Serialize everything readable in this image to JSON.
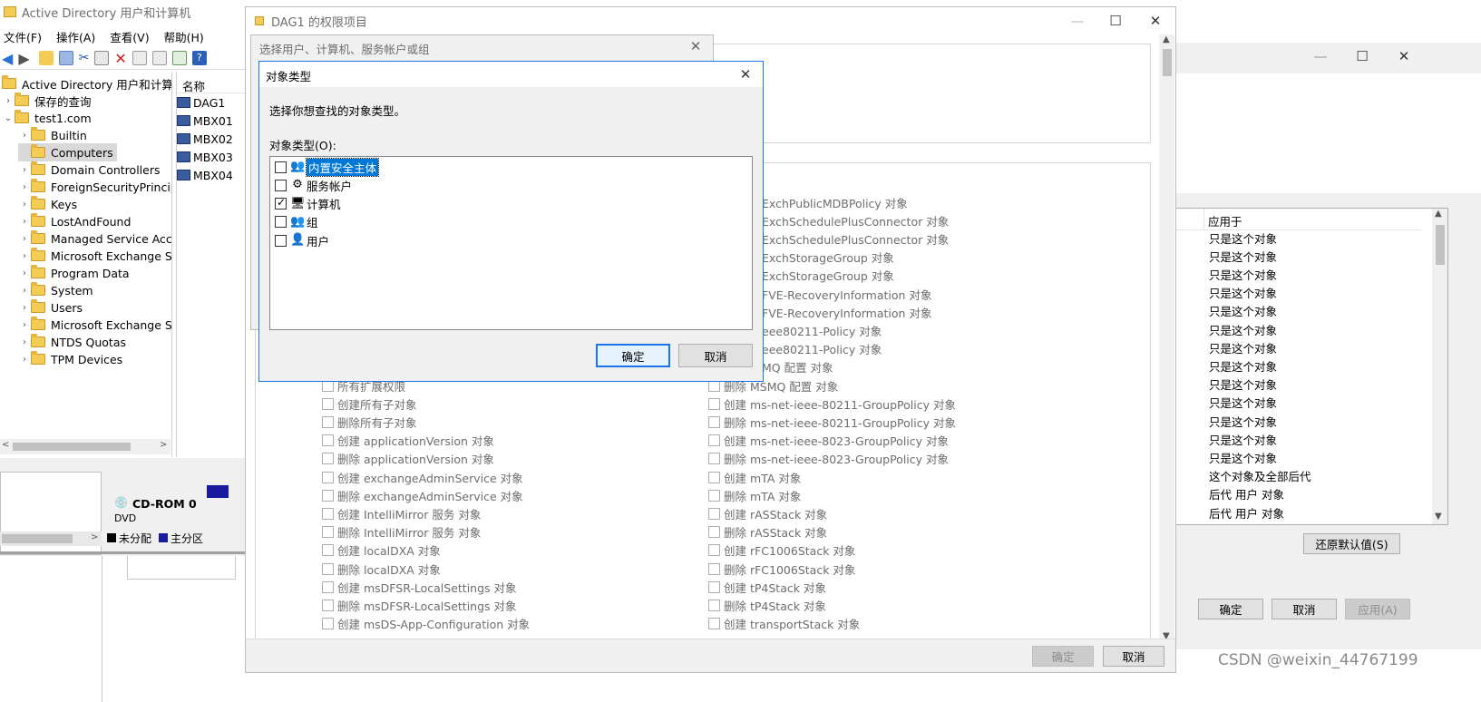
{
  "ad_window": {
    "title": "Active Directory 用户和计算机",
    "menu": [
      "文件(F)",
      "操作(A)",
      "查看(V)",
      "帮助(H)"
    ],
    "tree_root": "Active Directory 用户和计算机",
    "tree": [
      {
        "label": "保存的查询",
        "level": 1
      },
      {
        "label": "test1.com",
        "level": 0,
        "expanded": true
      },
      {
        "label": "Builtin",
        "level": 2
      },
      {
        "label": "Computers",
        "level": 2,
        "selected": true
      },
      {
        "label": "Domain Controllers",
        "level": 2
      },
      {
        "label": "ForeignSecurityPrincipa",
        "level": 2
      },
      {
        "label": "Keys",
        "level": 2
      },
      {
        "label": "LostAndFound",
        "level": 2
      },
      {
        "label": "Managed Service Acco",
        "level": 2
      },
      {
        "label": "Microsoft Exchange Se",
        "level": 2
      },
      {
        "label": "Program Data",
        "level": 2
      },
      {
        "label": "System",
        "level": 2
      },
      {
        "label": "Users",
        "level": 2
      },
      {
        "label": "Microsoft Exchange Sy",
        "level": 2
      },
      {
        "label": "NTDS Quotas",
        "level": 2
      },
      {
        "label": "TPM Devices",
        "level": 2
      }
    ],
    "list_header": "名称",
    "list_items": [
      "DAG1",
      "MBX01",
      "MBX02",
      "MBX03",
      "MBX04"
    ],
    "disk_label": "CD-ROM 0",
    "disk_sub": "DVD",
    "legend": [
      "未分配",
      "主分区"
    ]
  },
  "perm_window": {
    "title": "DAG1 的权限项目",
    "left_col": [
      "所有扩展权限",
      "创建所有子对象",
      "删除所有子对象",
      "创建 applicationVersion 对象",
      "删除 applicationVersion 对象",
      "创建 exchangeAdminService 对象",
      "删除 exchangeAdminService 对象",
      "创建 IntelliMirror 服务 对象",
      "删除 IntelliMirror 服务 对象",
      "创建 localDXA 对象",
      "删除 localDXA 对象",
      "创建 msDFSR-LocalSettings 对象",
      "删除 msDFSR-LocalSettings 对象",
      "创建 msDS-App-Configuration 对象"
    ],
    "right_col": [
      "ExchPublicMDBPolicy 对象",
      "ExchSchedulePlusConnector 对象",
      "ExchSchedulePlusConnector 对象",
      "ExchStorageGroup 对象",
      "ExchStorageGroup 对象",
      "FVE-RecoveryInformation 对象",
      "FVE-RecoveryInformation 对象",
      "eee80211-Policy 对象",
      "eee80211-Policy 对象",
      "MQ 配置 对象",
      "删除 MSMQ 配置 对象",
      "创建 ms-net-ieee-80211-GroupPolicy 对象",
      "删除 ms-net-ieee-80211-GroupPolicy 对象",
      "创建 ms-net-ieee-8023-GroupPolicy 对象",
      "删除 ms-net-ieee-8023-GroupPolicy 对象",
      "创建 mTA 对象",
      "删除 mTA 对象",
      "创建 rASStack 对象",
      "删除 rASStack 对象",
      "创建 rFC1006Stack 对象",
      "删除 rFC1006Stack 对象",
      "创建 tP4Stack 对象",
      "删除 tP4Stack 对象",
      "创建 transportStack 对象"
    ],
    "ok_label": "确定",
    "cancel_label": "取消"
  },
  "security_window": {
    "applies_header": "应用于",
    "applies": [
      "只是这个对象",
      "只是这个对象",
      "只是这个对象",
      "只是这个对象",
      "只是这个对象",
      "只是这个对象",
      "只是这个对象",
      "只是这个对象",
      "只是这个对象",
      "只是这个对象",
      "只是这个对象",
      "只是这个对象",
      "只是这个对象",
      "这个对象及全部后代",
      "后代 用户 对象",
      "后代 用户 对象"
    ],
    "restore_label": "还原默认值(S)",
    "ok_label": "确定",
    "cancel_label": "取消",
    "apply_label": "应用(A)"
  },
  "select_dialog": {
    "title": "选择用户、计算机、服务帐户或组"
  },
  "object_types_dialog": {
    "title": "对象类型",
    "prompt": "选择你想查找的对象类型。",
    "list_label": "对象类型(O):",
    "items": [
      {
        "label": "内置安全主体",
        "checked": false,
        "selected": true,
        "icon": "👥"
      },
      {
        "label": "服务帐户",
        "checked": false,
        "icon": "⚙"
      },
      {
        "label": "计算机",
        "checked": true,
        "icon": "🖥"
      },
      {
        "label": "组",
        "checked": false,
        "icon": "👥"
      },
      {
        "label": "用户",
        "checked": false,
        "icon": "👤"
      }
    ],
    "ok_label": "确定",
    "cancel_label": "取消"
  },
  "watermark": "CSDN @weixin_44767199"
}
